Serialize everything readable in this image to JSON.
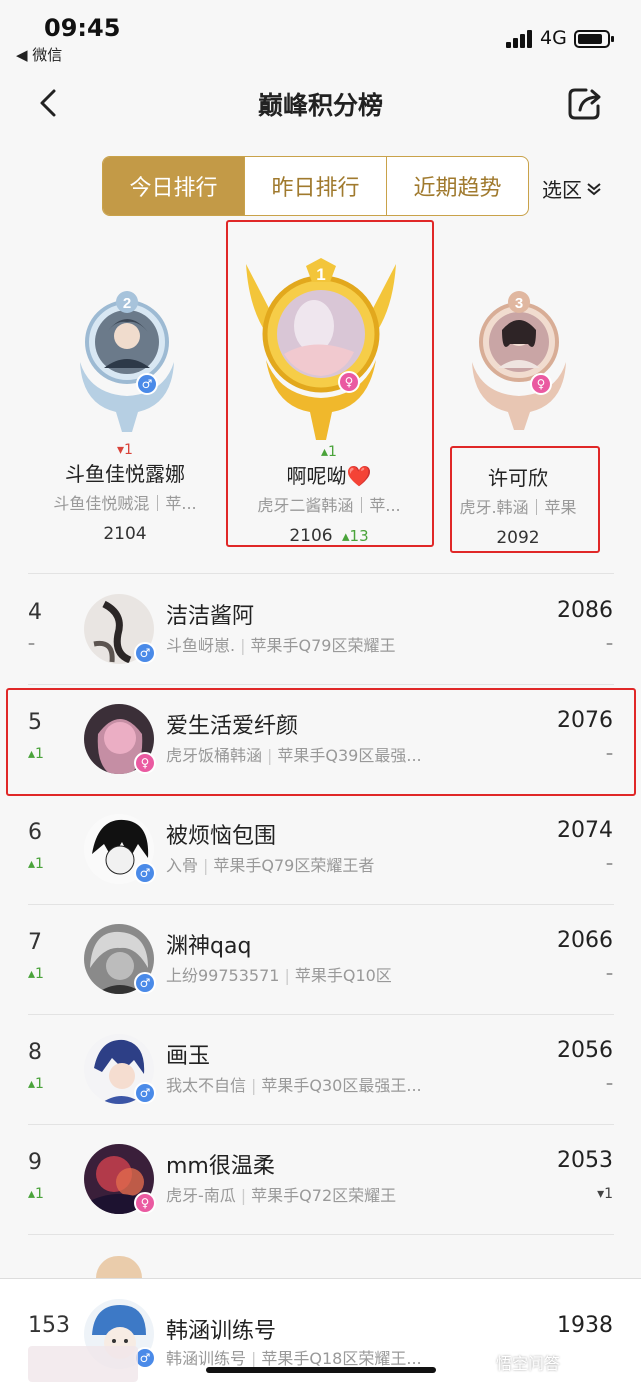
{
  "status": {
    "time": "09:45",
    "back_app": "◀ 微信",
    "network": "4G"
  },
  "nav": {
    "title": "巅峰积分榜"
  },
  "tabs": [
    {
      "label": "今日排行",
      "active": true
    },
    {
      "label": "昨日排行",
      "active": false
    },
    {
      "label": "近期趋势",
      "active": false
    }
  ],
  "region": {
    "label": "选区"
  },
  "podium": {
    "second": {
      "rank": "2",
      "change": "▾1",
      "name": "斗鱼佳悦露娜",
      "sub": "斗鱼佳悦贼混｜苹...",
      "score": "2104",
      "gender": "♂"
    },
    "first": {
      "rank": "1",
      "change": "▴1",
      "name": "啊呢呦❤️",
      "sub": "虎牙二酱韩涵｜苹...",
      "score": "2106",
      "score_delta": "▴13",
      "gender": "♀"
    },
    "third": {
      "rank": "3",
      "name": "许可欣",
      "sub": "虎牙.韩涵｜苹果",
      "score": "2092",
      "gender": "♀"
    }
  },
  "rows": [
    {
      "rank": "4",
      "change": "–",
      "name": "洁洁酱阿",
      "tag": "斗鱼岈崽.",
      "area": "苹果手Q79区荣耀王",
      "score": "2086",
      "delta": "–",
      "gender": "♂"
    },
    {
      "rank": "5",
      "change": "▴1",
      "name": "爱生活爱纤颜",
      "tag": "虎牙饭桶韩涵",
      "area": "苹果手Q39区最强...",
      "score": "2076",
      "delta": "–",
      "gender": "♀"
    },
    {
      "rank": "6",
      "change": "▴1",
      "name": "被烦恼包围",
      "tag": "入骨",
      "area": "苹果手Q79区荣耀王者",
      "score": "2074",
      "delta": "–",
      "gender": "♂"
    },
    {
      "rank": "7",
      "change": "▴1",
      "name": "渊神qaq",
      "tag": "上纷99753571",
      "area": "苹果手Q10区",
      "score": "2066",
      "delta": "–",
      "gender": "♂"
    },
    {
      "rank": "8",
      "change": "▴1",
      "name": "画玉",
      "tag": "我太不自信",
      "area": "苹果手Q30区最强王...",
      "score": "2056",
      "delta": "–",
      "gender": "♂"
    },
    {
      "rank": "9",
      "change": "▴1",
      "name": "mm很温柔",
      "tag": "虎牙-南瓜",
      "area": "苹果手Q72区荣耀王",
      "score": "2053",
      "delta": "▾1",
      "gender": "♀"
    }
  ],
  "me": {
    "rank": "153",
    "name": "韩涵训练号",
    "tag": "韩涵训练号",
    "area": "苹果手Q18区荣耀王...",
    "score": "1938",
    "gender": "♂"
  },
  "watermark": "悟空问答",
  "colors": {
    "gold": "#c39a47",
    "up": "#4aa33a",
    "down": "#d9433a",
    "highlight": "#e02828",
    "male": "#4a8ae8",
    "female": "#ea5aa1"
  }
}
